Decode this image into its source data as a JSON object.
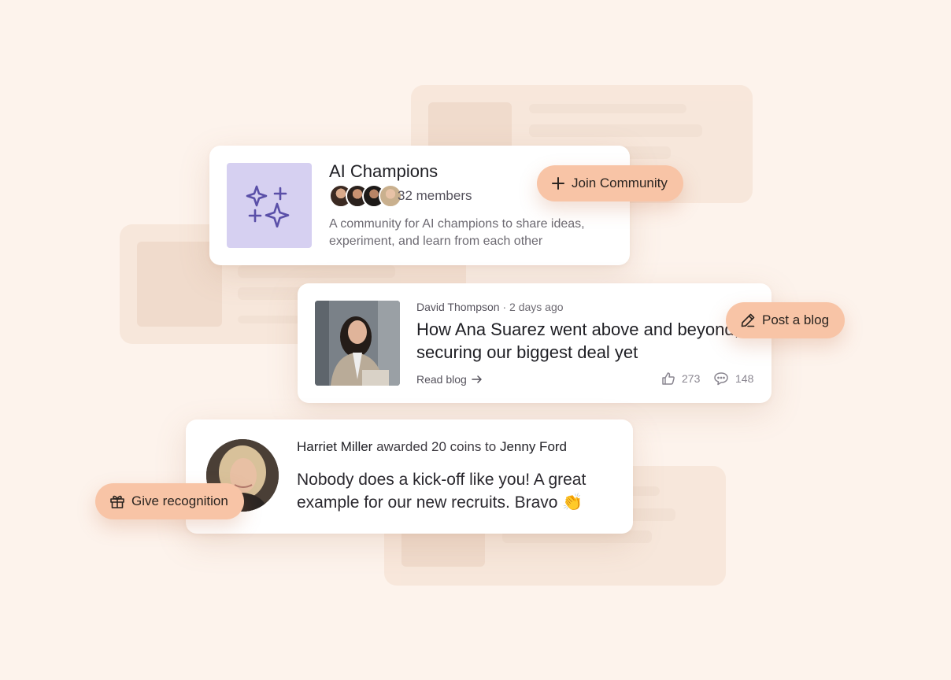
{
  "community": {
    "title": "AI Champions",
    "members": "32 members",
    "description": "A community for AI champions to share ideas, experiment, and learn from each other",
    "join_label": "Join Community"
  },
  "blog": {
    "author": "David Thompson",
    "separator": "·",
    "time": "2 days ago",
    "title": "How Ana Suarez went above and beyond, securing our biggest deal yet",
    "read_label": "Read blog",
    "likes": "273",
    "comments": "148",
    "post_label": "Post a blog"
  },
  "recognition": {
    "giver": "Harriet Miller",
    "action": "awarded 20 coins to",
    "receiver": "Jenny Ford",
    "message": "Nobody does a kick-off like you! A great example for our new recruits. Bravo 👏",
    "give_label": "Give recognition"
  },
  "colors": {
    "background": "#fdf3ec",
    "pill": "#f8c4a6",
    "community_thumb": "#d6d0f1",
    "sparkle": "#5a4fa8"
  },
  "icons": [
    "sparkles-icon",
    "plus-icon",
    "pencil-icon",
    "arrow-right-icon",
    "thumbs-up-icon",
    "comment-icon",
    "gift-icon"
  ]
}
